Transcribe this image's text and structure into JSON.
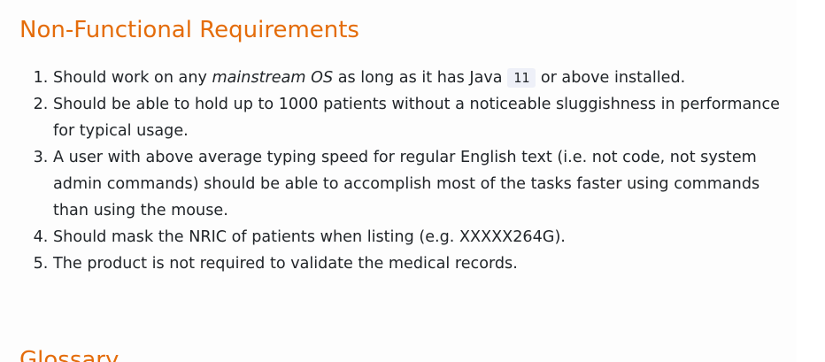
{
  "section": {
    "title": "Non-Functional Requirements",
    "items": [
      {
        "pre": "Should work on any ",
        "em": "mainstream OS",
        "mid": " as long as it has Java ",
        "code": "11",
        "post": " or above installed."
      },
      {
        "text": "Should be able to hold up to 1000 patients without a noticeable sluggishness in performance for typical usage."
      },
      {
        "text": "A user with above average typing speed for regular English text (i.e. not code, not system admin commands) should be able to accomplish most of the tasks faster using commands than using the mouse."
      },
      {
        "text": "Should mask the NRIC of patients when listing (e.g. XXXXX264G)."
      },
      {
        "text": "The product is not required to validate the medical records."
      }
    ]
  },
  "next_section": {
    "title": "Glossary"
  },
  "colors": {
    "heading": "#e46c0a",
    "text": "#212529",
    "code_bg": "#eef0f8",
    "page_bg": "#fdfdfd"
  }
}
